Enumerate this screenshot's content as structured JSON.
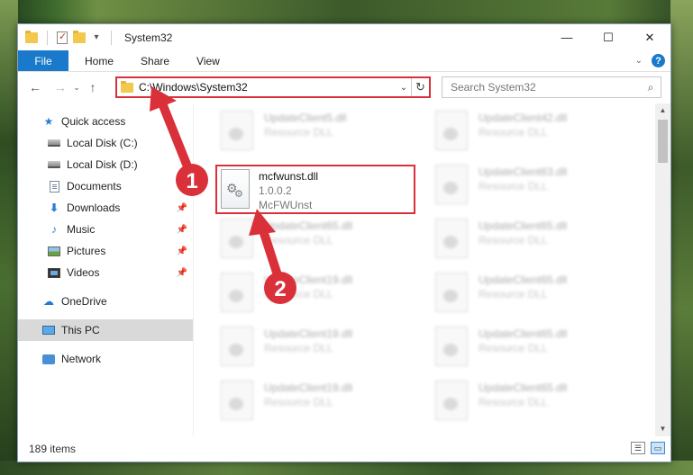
{
  "window": {
    "title": "System32",
    "controls": {
      "minimize": "—",
      "maximize": "☐",
      "close": "✕"
    }
  },
  "ribbon": {
    "tabs": [
      "File",
      "Home",
      "Share",
      "View"
    ],
    "collapse_glyph": "⌄",
    "help_glyph": "?"
  },
  "navigation": {
    "back_glyph": "←",
    "forward_glyph": "→",
    "recent_glyph": "⌄",
    "up_glyph": "↑",
    "address": "C:\\Windows\\System32",
    "address_drop_glyph": "⌄",
    "refresh_glyph": "↻",
    "search_placeholder": "Search System32",
    "search_glyph": "⌕"
  },
  "sidebar": {
    "items": [
      {
        "label": "Quick access",
        "icon": "star-icon"
      },
      {
        "label": "Local Disk (C:)",
        "icon": "drive-icon"
      },
      {
        "label": "Local Disk (D:)",
        "icon": "drive-icon"
      },
      {
        "label": "Documents",
        "icon": "documents-icon"
      },
      {
        "label": "Downloads",
        "icon": "download-icon"
      },
      {
        "label": "Music",
        "icon": "music-icon"
      },
      {
        "label": "Pictures",
        "icon": "pictures-icon"
      },
      {
        "label": "Videos",
        "icon": "videos-icon"
      },
      {
        "label": "OneDrive",
        "icon": "onedrive-icon"
      },
      {
        "label": "This PC",
        "icon": "pc-icon"
      },
      {
        "label": "Network",
        "icon": "network-icon"
      }
    ],
    "pin_glyph": "📌",
    "selected": "This PC"
  },
  "files": {
    "highlighted": {
      "name": "mcfwunst.dll",
      "version": "1.0.0.2",
      "description": "McFWUnst"
    },
    "background": [
      {
        "name": "UpdateClient5.dll",
        "type": "Resource DLL"
      },
      {
        "name": "UpdateClient42.dll",
        "type": "Resource DLL"
      },
      {
        "name": "UpdateClient63.dll",
        "type": "Resource DLL"
      },
      {
        "name": "UpdateClient65.dll",
        "type": "Resource DLL"
      },
      {
        "name": "UpdateClient65.dll",
        "type": "Resource DLL"
      },
      {
        "name": "UpdateClient19.dll",
        "type": "Resource DLL"
      },
      {
        "name": "UpdateClient65.dll",
        "type": "Resource DLL"
      },
      {
        "name": "UpdateClient19.dll",
        "type": "Resource DLL"
      },
      {
        "name": "UpdateClient65.dll",
        "type": "Resource DLL"
      },
      {
        "name": "UpdateClient19.dll",
        "type": "Resource DLL"
      },
      {
        "name": "UpdateClient65.dll",
        "type": "Resource DLL"
      }
    ]
  },
  "status": {
    "item_count": "189 items"
  },
  "annotations": {
    "step1": "1",
    "step2": "2",
    "arrow_color": "#d9303a",
    "badge_color": "#d9303a"
  },
  "colors": {
    "accent": "#1979ca",
    "highlight_box": "#d9303a",
    "selected_nav": "#d9d9d9"
  }
}
